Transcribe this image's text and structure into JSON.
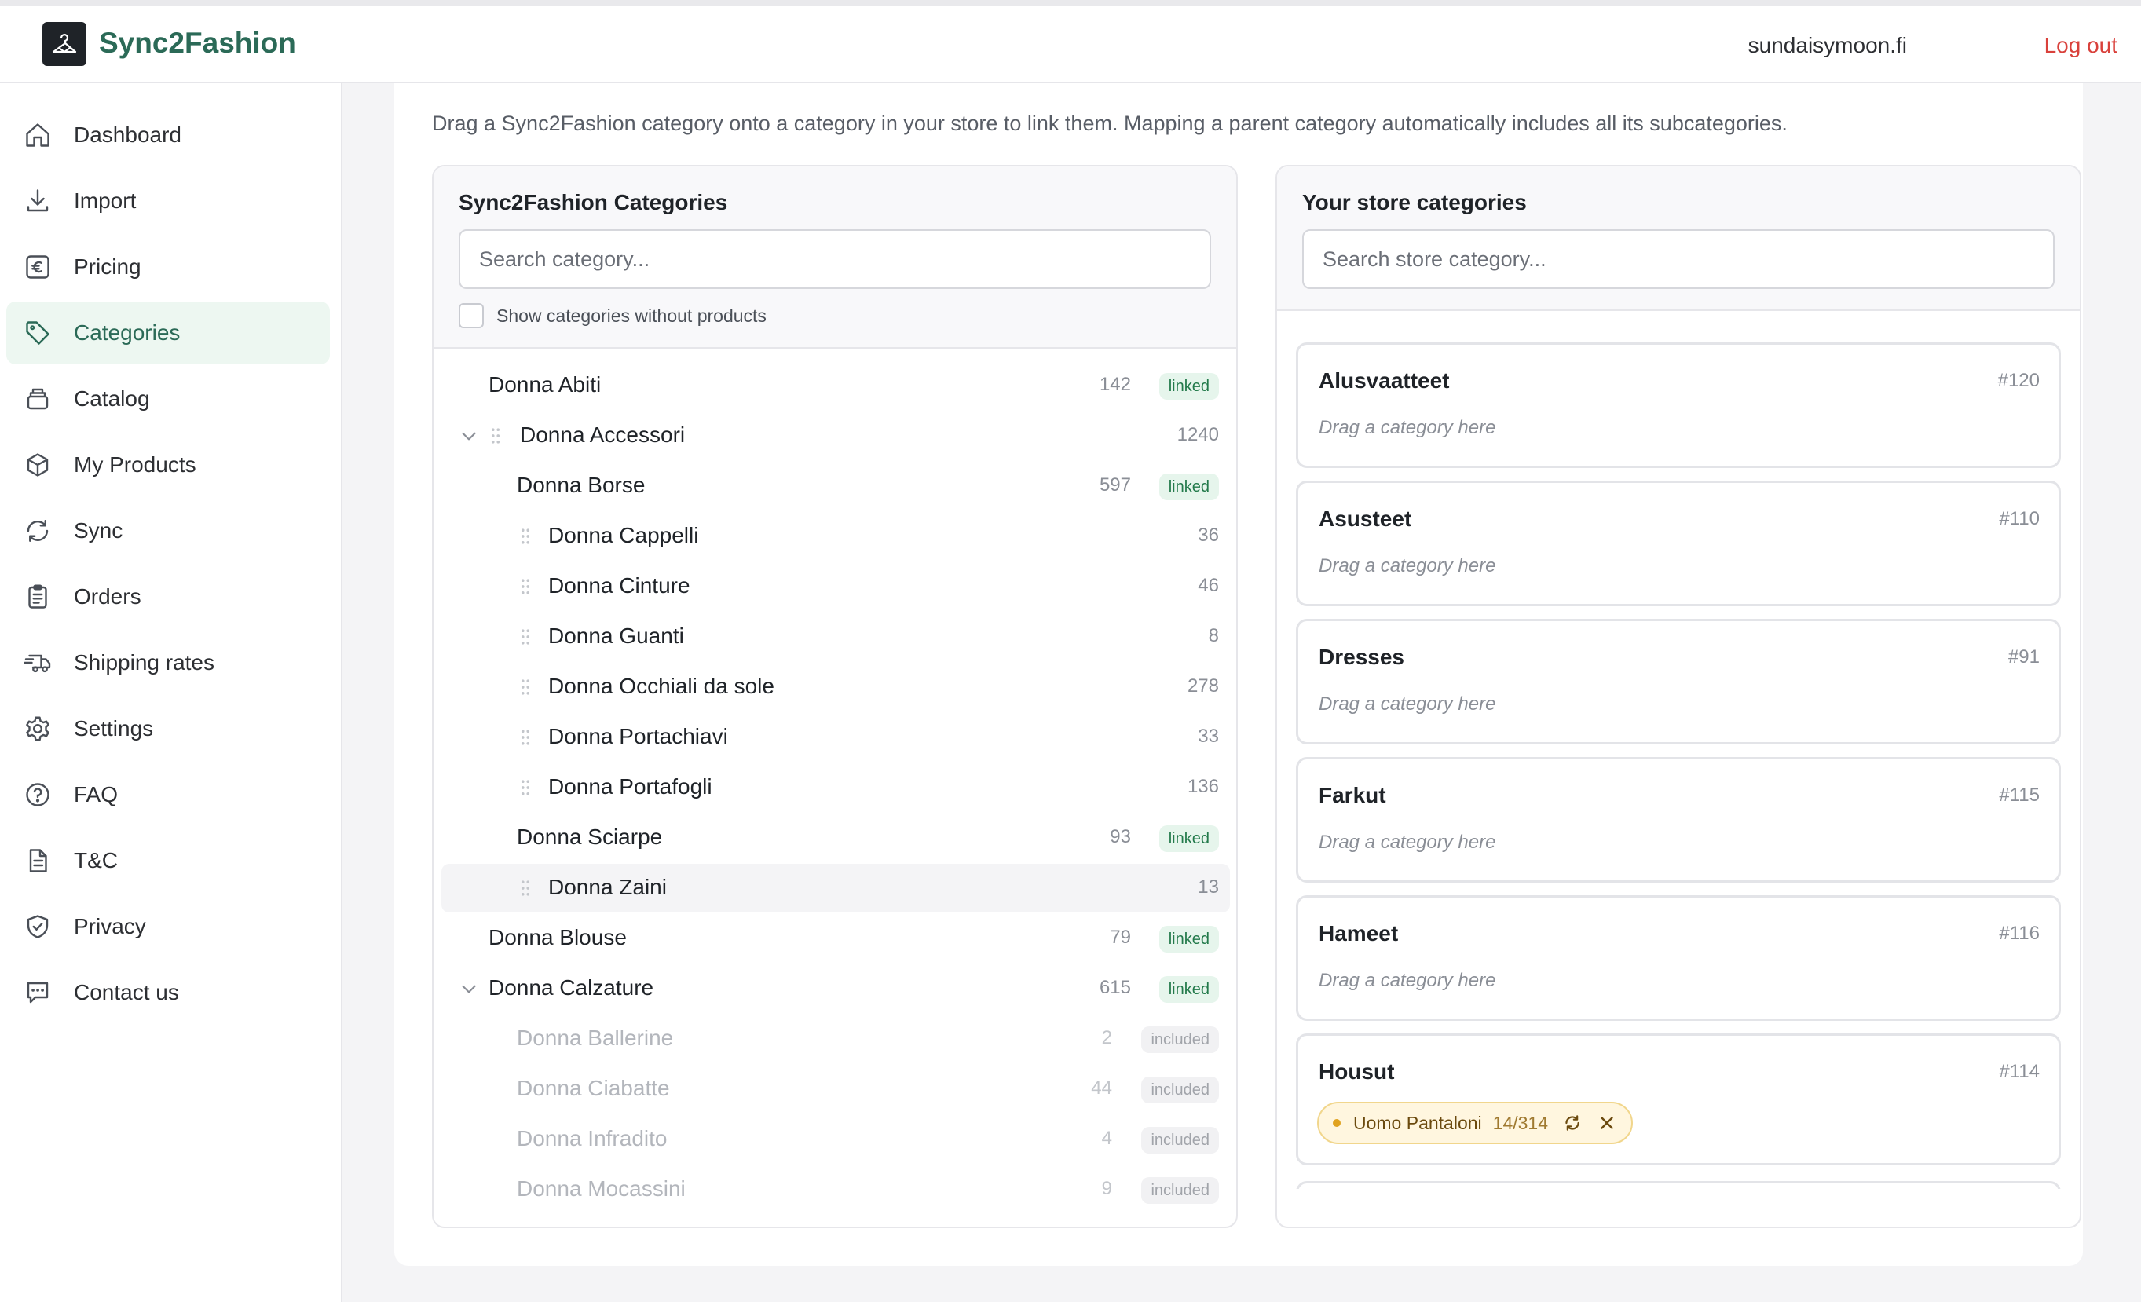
{
  "header": {
    "brand": "Sync2Fashion",
    "account": "sundaisymoon.fi",
    "logout_label": "Log out"
  },
  "sidebar": {
    "items": [
      {
        "label": "Dashboard",
        "icon": "home-icon"
      },
      {
        "label": "Import",
        "icon": "download-icon"
      },
      {
        "label": "Pricing",
        "icon": "euro-icon"
      },
      {
        "label": "Categories",
        "icon": "tag-icon",
        "active": true
      },
      {
        "label": "Catalog",
        "icon": "layers-icon"
      },
      {
        "label": "My Products",
        "icon": "box-icon"
      },
      {
        "label": "Sync",
        "icon": "sync-icon"
      },
      {
        "label": "Orders",
        "icon": "clipboard-icon"
      },
      {
        "label": "Shipping rates",
        "icon": "truck-icon"
      },
      {
        "label": "Settings",
        "icon": "gear-icon"
      },
      {
        "label": "FAQ",
        "icon": "help-icon"
      },
      {
        "label": "T&C",
        "icon": "document-icon"
      },
      {
        "label": "Privacy",
        "icon": "shield-icon"
      },
      {
        "label": "Contact us",
        "icon": "chat-icon"
      }
    ]
  },
  "main": {
    "intro": "Drag a Sync2Fashion category onto a category in your store to link them. Mapping a parent category automatically includes all its subcategories."
  },
  "left_panel": {
    "title": "Sync2Fashion Categories",
    "search_placeholder": "Search category...",
    "checkbox_label": "Show categories without products",
    "rows": [
      {
        "name": "Donna Abiti",
        "count": "142",
        "badge": "linked"
      },
      {
        "name": "Donna Accessori",
        "count": "1240",
        "badge": ""
      },
      {
        "name": "Donna Borse",
        "count": "597",
        "badge": "linked"
      },
      {
        "name": "Donna Cappelli",
        "count": "36",
        "badge": ""
      },
      {
        "name": "Donna Cinture",
        "count": "46",
        "badge": ""
      },
      {
        "name": "Donna Guanti",
        "count": "8",
        "badge": ""
      },
      {
        "name": "Donna Occhiali da sole",
        "count": "278",
        "badge": ""
      },
      {
        "name": "Donna Portachiavi",
        "count": "33",
        "badge": ""
      },
      {
        "name": "Donna Portafogli",
        "count": "136",
        "badge": ""
      },
      {
        "name": "Donna Sciarpe",
        "count": "93",
        "badge": "linked"
      },
      {
        "name": "Donna Zaini",
        "count": "13",
        "badge": ""
      },
      {
        "name": "Donna Blouse",
        "count": "79",
        "badge": "linked"
      },
      {
        "name": "Donna Calzature",
        "count": "615",
        "badge": "linked"
      },
      {
        "name": "Donna Ballerine",
        "count": "2",
        "badge": "included"
      },
      {
        "name": "Donna Ciabatte",
        "count": "44",
        "badge": "included"
      },
      {
        "name": "Donna Infradito",
        "count": "4",
        "badge": "included"
      },
      {
        "name": "Donna Mocassini",
        "count": "9",
        "badge": "included"
      }
    ]
  },
  "right_panel": {
    "title": "Your store categories",
    "search_placeholder": "Search store category...",
    "drop_hint": "Drag a category here",
    "cards": [
      {
        "name": "Alusvaatteet",
        "id": "#120"
      },
      {
        "name": "Asusteet",
        "id": "#110"
      },
      {
        "name": "Dresses",
        "id": "#91"
      },
      {
        "name": "Farkut",
        "id": "#115"
      },
      {
        "name": "Hameet",
        "id": "#116"
      },
      {
        "name": "Housut",
        "id": "#114",
        "chip": {
          "name": "Uomo Pantaloni",
          "count": "14/314"
        }
      }
    ]
  },
  "colors": {
    "brand": "#2b6a57",
    "logout": "#d9413b",
    "linked_bg": "#e6f5ec",
    "linked_text": "#237a4b",
    "chip_bg": "#fff6df"
  }
}
